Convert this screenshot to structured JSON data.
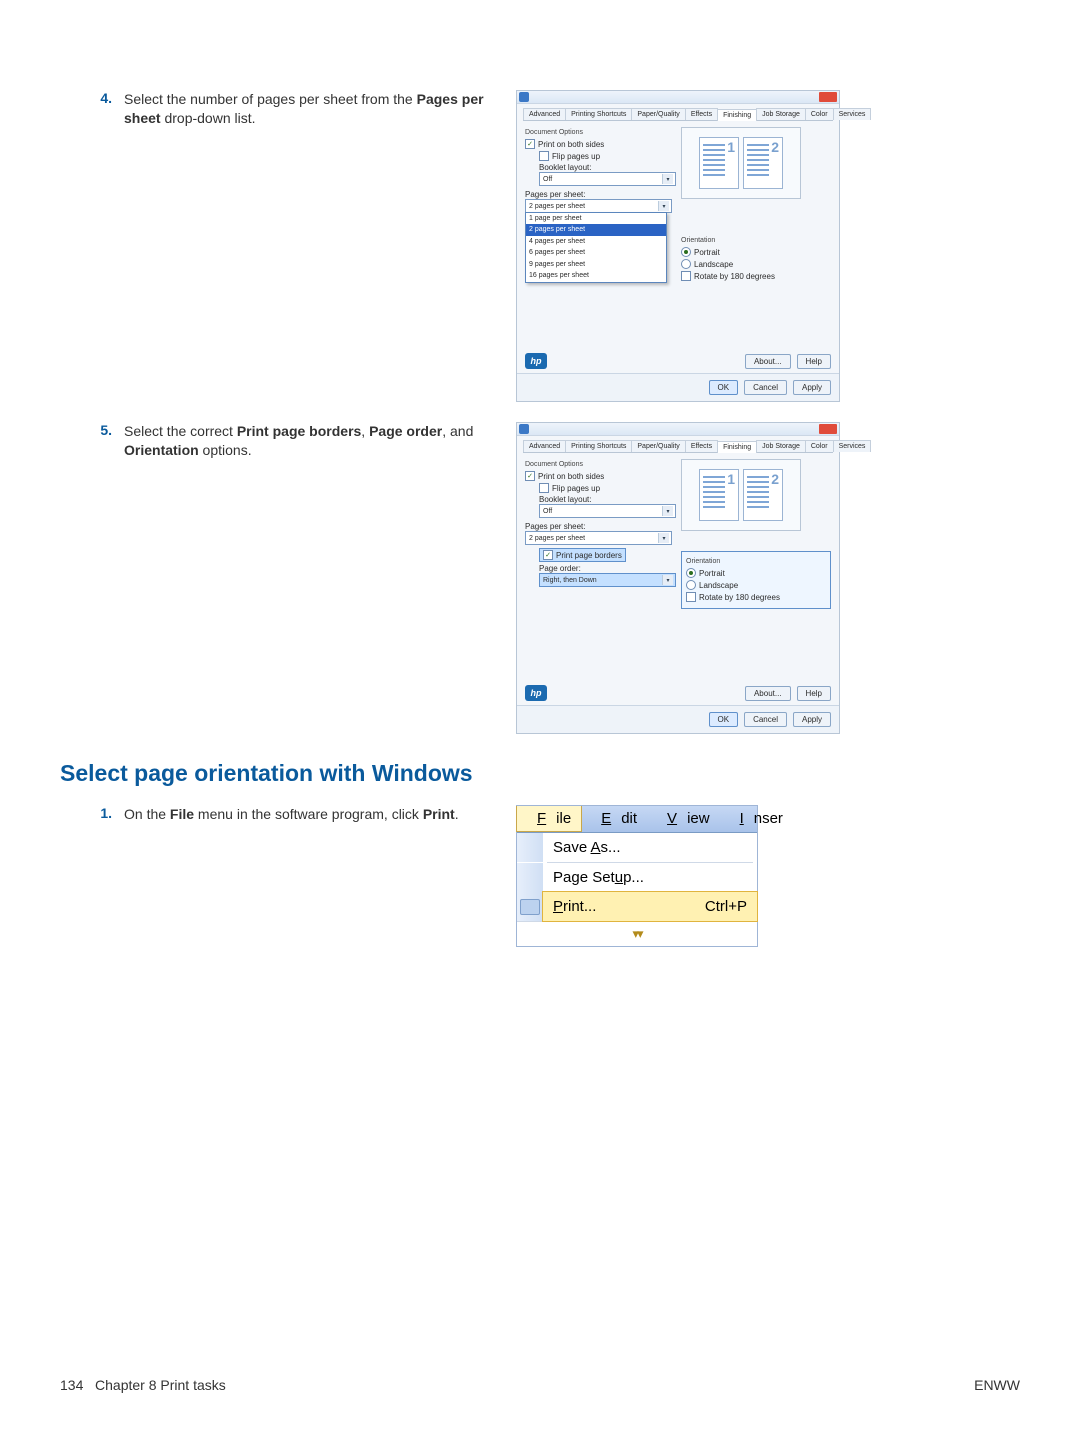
{
  "step4": {
    "num": "4.",
    "text_a": "Select the number of pages per sheet from the ",
    "bold_a": "Pages per sheet",
    "text_b": " drop-down list."
  },
  "step5": {
    "num": "5.",
    "text_a": "Select the correct ",
    "bold_a": "Print page borders",
    "text_b": ", ",
    "bold_b": "Page order",
    "text_c": ", and ",
    "bold_c": "Orientation",
    "text_d": " options."
  },
  "section_heading": "Select page orientation with Windows",
  "step1": {
    "num": "1.",
    "text_a": "On the ",
    "bold_a": "File",
    "text_b": " menu in the software program, click ",
    "bold_b": "Print",
    "text_c": "."
  },
  "dlg": {
    "tabs": [
      "Advanced",
      "Printing Shortcuts",
      "Paper/Quality",
      "Effects",
      "Finishing",
      "Job Storage",
      "Color",
      "Services"
    ],
    "doc_options": "Document Options",
    "print_both": "Print on both sides",
    "flip_up": "Flip pages up",
    "booklet_label": "Booklet layout:",
    "booklet_value": "Off",
    "pps_label": "Pages per sheet:",
    "pps_value": "2 pages per sheet",
    "pps_options": [
      "1 page per sheet",
      "2 pages per sheet",
      "4 pages per sheet",
      "6 pages per sheet",
      "9 pages per sheet",
      "16 pages per sheet"
    ],
    "borders": "Print page borders",
    "order_label": "Page order:",
    "order_value": "Right, then Down",
    "orientation_label": "Orientation",
    "orient_portrait": "Portrait",
    "orient_landscape": "Landscape",
    "rotate": "Rotate by 180 degrees",
    "about": "About...",
    "help": "Help",
    "ok": "OK",
    "cancel": "Cancel",
    "apply": "Apply",
    "preview_1": "1",
    "preview_2": "2",
    "hp": "hp"
  },
  "menu": {
    "items": [
      "File",
      "Edit",
      "View",
      "Inser"
    ],
    "save_as": "Save As...",
    "page_setup": "Page Setup...",
    "print": "Print...",
    "print_shortcut": "Ctrl+P",
    "underline": {
      "file": "F",
      "edit": "E",
      "view": "V",
      "inser": "I",
      "save_as": "A",
      "page_setup": "u",
      "print": "P"
    }
  },
  "footer": {
    "page_num": "134",
    "chapter": "Chapter 8   Print tasks",
    "right": "ENWW"
  }
}
